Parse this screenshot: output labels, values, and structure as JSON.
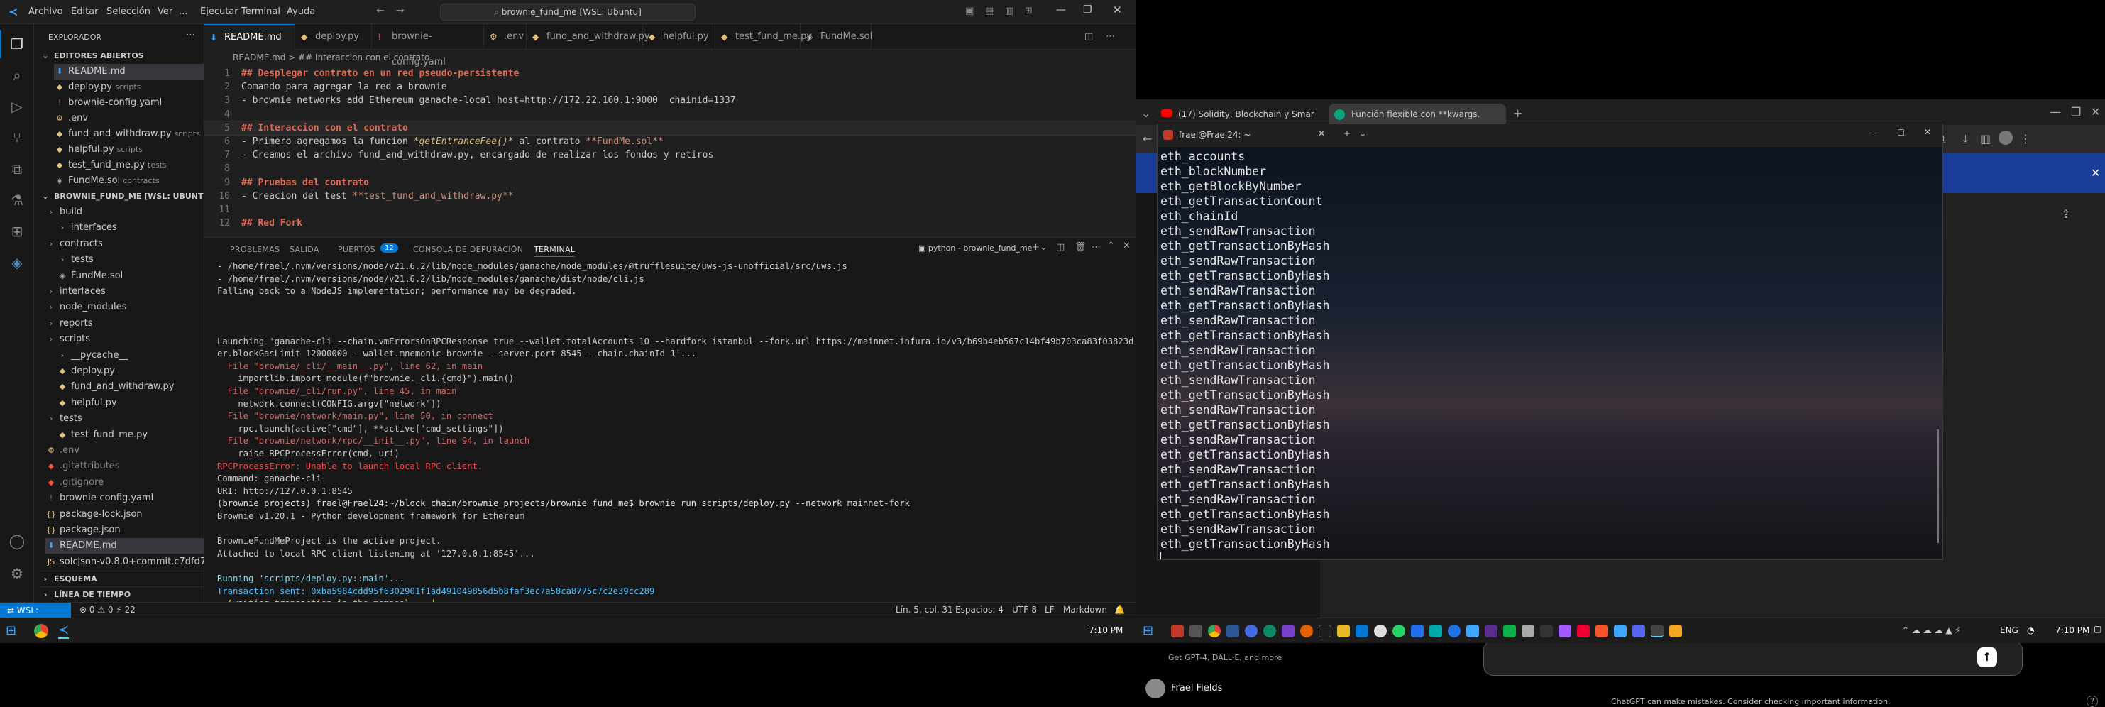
{
  "vscode": {
    "menu": [
      "Archivo",
      "Editar",
      "Selección",
      "Ver",
      "...",
      "Ejecutar",
      "Terminal",
      "Ayuda"
    ],
    "command_center": "brownie_fund_me [WSL: Ubuntu]",
    "sidebar": {
      "title": "EXPLORADOR",
      "open_editors_title": "EDITORES ABIERTOS",
      "open_editors": [
        {
          "name": "README.md",
          "sub": ""
        },
        {
          "name": "deploy.py",
          "sub": "scripts"
        },
        {
          "name": "brownie-config.yaml",
          "sub": ""
        },
        {
          "name": ".env",
          "sub": ""
        },
        {
          "name": "fund_and_withdraw.py",
          "sub": "scripts"
        },
        {
          "name": "helpful.py",
          "sub": "scripts"
        },
        {
          "name": "test_fund_me.py",
          "sub": "tests"
        },
        {
          "name": "FundMe.sol",
          "sub": "contracts"
        }
      ],
      "project_title": "BROWNIE_FUND_ME [WSL: UBUNTU]",
      "tree": [
        {
          "name": "build",
          "depth": 0,
          "type": "folder"
        },
        {
          "name": "interfaces",
          "depth": 1,
          "type": "folder"
        },
        {
          "name": "contracts",
          "depth": 0,
          "type": "folder"
        },
        {
          "name": "tests",
          "depth": 1,
          "type": "folder"
        },
        {
          "name": "FundMe.sol",
          "depth": 1,
          "type": "sol"
        },
        {
          "name": "interfaces",
          "depth": 0,
          "type": "folder"
        },
        {
          "name": "node_modules",
          "depth": 0,
          "type": "folder"
        },
        {
          "name": "reports",
          "depth": 0,
          "type": "folder"
        },
        {
          "name": "scripts",
          "depth": 0,
          "type": "folder"
        },
        {
          "name": "__pycache__",
          "depth": 1,
          "type": "folder"
        },
        {
          "name": "deploy.py",
          "depth": 1,
          "type": "py"
        },
        {
          "name": "fund_and_withdraw.py",
          "depth": 1,
          "type": "py"
        },
        {
          "name": "helpful.py",
          "depth": 1,
          "type": "py"
        },
        {
          "name": "tests",
          "depth": 0,
          "type": "folder"
        },
        {
          "name": "test_fund_me.py",
          "depth": 1,
          "type": "py"
        },
        {
          "name": ".env",
          "depth": 0,
          "type": "env"
        },
        {
          "name": ".gitattributes",
          "depth": 0,
          "type": "git"
        },
        {
          "name": ".gitignore",
          "depth": 0,
          "type": "git"
        },
        {
          "name": "brownie-config.yaml",
          "depth": 0,
          "type": "yaml"
        },
        {
          "name": "package-lock.json",
          "depth": 0,
          "type": "json"
        },
        {
          "name": "package.json",
          "depth": 0,
          "type": "json"
        },
        {
          "name": "README.md",
          "depth": 0,
          "type": "md"
        },
        {
          "name": "solcjson-v0.8.0+commit.c7dfd78e.js",
          "depth": 0,
          "type": "js"
        }
      ],
      "outline_title": "ESQUEMA",
      "timeline_title": "LÍNEA DE TIEMPO"
    },
    "tabs": [
      {
        "label": "README.md",
        "active": true
      },
      {
        "label": "deploy.py",
        "active": false
      },
      {
        "label": "brownie-config.yaml",
        "active": false
      },
      {
        "label": ".env",
        "active": false
      },
      {
        "label": "fund_and_withdraw.py",
        "active": false
      },
      {
        "label": "helpful.py",
        "active": false
      },
      {
        "label": "test_fund_me.py",
        "active": false
      },
      {
        "label": "FundMe.sol",
        "active": false
      }
    ],
    "breadcrumb": "README.md > ## Interaccion con el contrato",
    "code": [
      {
        "n": "1",
        "h": "## Desplegar contrato en un red pseudo-persistente",
        "type": "h"
      },
      {
        "n": "2",
        "h": "Comando para agregar la red a brownie",
        "type": "t"
      },
      {
        "n": "3",
        "h": "- brownie networks add Ethereum ganache-local host=http://172.22.160.1:9000  chainid=1337",
        "type": "t"
      },
      {
        "n": "4",
        "h": "",
        "type": "t"
      },
      {
        "n": "5",
        "h": "## Interaccion con el contrato",
        "type": "h"
      },
      {
        "n": "6",
        "h": "- Primero agregamos la funcion ",
        "it": "getEntranceFee()",
        "b": "**FundMe.sol**",
        "mid": " al contrato ",
        "type": "mix"
      },
      {
        "n": "7",
        "h": "- Creamos el archivo fund_and_withdraw.py, encargado de realizar los fondos y retiros",
        "type": "t"
      },
      {
        "n": "8",
        "h": "",
        "type": "t"
      },
      {
        "n": "9",
        "h": "## Pruebas del contrato",
        "type": "h"
      },
      {
        "n": "10",
        "h": "- Creacion del test ",
        "b": "**test_fund_and_withdraw.py**",
        "type": "tb"
      },
      {
        "n": "11",
        "h": "",
        "type": "t"
      },
      {
        "n": "12",
        "h": "## Red Fork",
        "type": "h"
      }
    ],
    "panel_tabs": [
      "PROBLEMAS",
      "SALIDA",
      "PUERTOS",
      "CONSOLA DE DEPURACIÓN",
      "TERMINAL"
    ],
    "ports_badge": "12",
    "terminal_profile": "python - brownie_fund_me",
    "terminal": [
      {
        "t": "- /home/frael/.nvm/versions/node/v21.6.2/lib/node_modules/ganache/node_modules/@trufflesuite/uws-js-unofficial/src/uws.js",
        "c": ""
      },
      {
        "t": "- /home/frael/.nvm/versions/node/v21.6.2/lib/node_modules/ganache/dist/node/cli.js",
        "c": ""
      },
      {
        "t": "Falling back to a NodeJS implementation; performance may be degraded.",
        "c": ""
      },
      {
        "t": "",
        "c": ""
      },
      {
        "t": "",
        "c": ""
      },
      {
        "t": "",
        "c": ""
      },
      {
        "t": "Launching 'ganache-cli --chain.vmErrorsOnRPCResponse true --wallet.totalAccounts 10 --hardfork istanbul --fork.url https://mainnet.infura.io/v3/b69b4eb567c14bf49b703ca83f03823d --min",
        "c": ""
      },
      {
        "t": "er.blockGasLimit 12000000 --wallet.mnemonic brownie --server.port 8545 --chain.chainId 1'...",
        "c": ""
      },
      {
        "t": "  File \"brownie/_cli/__main__.py\", line 62, in main",
        "c": "file"
      },
      {
        "t": "    importlib.import_module(f\"brownie._cli.{cmd}\").main()",
        "c": ""
      },
      {
        "t": "  File \"brownie/_cli/run.py\", line 45, in main",
        "c": "file"
      },
      {
        "t": "    network.connect(CONFIG.argv[\"network\"])",
        "c": ""
      },
      {
        "t": "  File \"brownie/network/main.py\", line 50, in connect",
        "c": "file"
      },
      {
        "t": "    rpc.launch(active[\"cmd\"], **active[\"cmd_settings\"])",
        "c": ""
      },
      {
        "t": "  File \"brownie/network/rpc/__init__.py\", line 94, in launch",
        "c": "file"
      },
      {
        "t": "    raise RPCProcessError(cmd, uri)",
        "c": ""
      },
      {
        "t": "RPCProcessError: Unable to launch local RPC client.",
        "c": "err"
      },
      {
        "t": "Command: ganache-cli",
        "c": ""
      },
      {
        "t": "URI: http://127.0.0.1:8545",
        "c": ""
      },
      {
        "t": "(brownie_projects) frael@Frael24:~/block_chain/brownie_projects/brownie_fund_me$ brownie run scripts/deploy.py --network mainnet-fork",
        "c": "prompt"
      },
      {
        "t": "Brownie v1.20.1 - Python development framework for Ethereum",
        "c": ""
      },
      {
        "t": "",
        "c": ""
      },
      {
        "t": "BrownieFundMeProject is the active project.",
        "c": ""
      },
      {
        "t": "Attached to local RPC client listening at '127.0.0.1:8545'...",
        "c": ""
      },
      {
        "t": "",
        "c": ""
      },
      {
        "t": "Running 'scripts/deploy.py::main'...",
        "c": "run"
      },
      {
        "t": "Transaction sent: 0xba5984cdd95f6302901f1ad491049856d5b8faf3ec7a58ca8775c7c2e39cc289",
        "c": "tx"
      },
      {
        "t": "  Awaiting transaction in the mempool... |",
        "c": "await"
      }
    ],
    "status": {
      "remote": "WSL: Ubuntu",
      "left": "⊗ 0 ⚠ 0   ⚡ 22",
      "position": "Lín. 5, col. 31",
      "spaces": "Espacios: 4",
      "encoding": "UTF-8",
      "eol": "LF",
      "lang": "Markdown"
    },
    "clock": "7:10 PM"
  },
  "chrome": {
    "tabs": [
      "(17) Solidity, Blockchain y Smar",
      "Función flexible con **kwargs."
    ],
    "gpt_sidebar": {
      "upgrade_text": "Get GPT-4, DALL·E, and more",
      "user": "Frael Fields"
    },
    "gpt_main": {
      "disclaimer": "ChatGPT can make mistakes. Consider checking important information.",
      "help": "?"
    }
  },
  "wsl_terminal": {
    "title": "frael@Frael24: ~",
    "lines": [
      "eth_accounts",
      "eth_blockNumber",
      "eth_getBlockByNumber",
      "eth_getTransactionCount",
      "eth_chainId",
      "eth_sendRawTransaction",
      "eth_getTransactionByHash",
      "eth_sendRawTransaction",
      "eth_getTransactionByHash",
      "eth_sendRawTransaction",
      "eth_getTransactionByHash",
      "eth_sendRawTransaction",
      "eth_getTransactionByHash",
      "eth_sendRawTransaction",
      "eth_getTransactionByHash",
      "eth_sendRawTransaction",
      "eth_getTransactionByHash",
      "eth_sendRawTransaction",
      "eth_getTransactionByHash",
      "eth_sendRawTransaction",
      "eth_getTransactionByHash",
      "eth_sendRawTransaction",
      "eth_getTransactionByHash",
      "eth_sendRawTransaction",
      "eth_getTransactionByHash",
      "eth_sendRawTransaction",
      "eth_getTransactionByHash"
    ]
  },
  "taskbar_right": {
    "lang": "ENG",
    "clock": "7:10 PM"
  }
}
